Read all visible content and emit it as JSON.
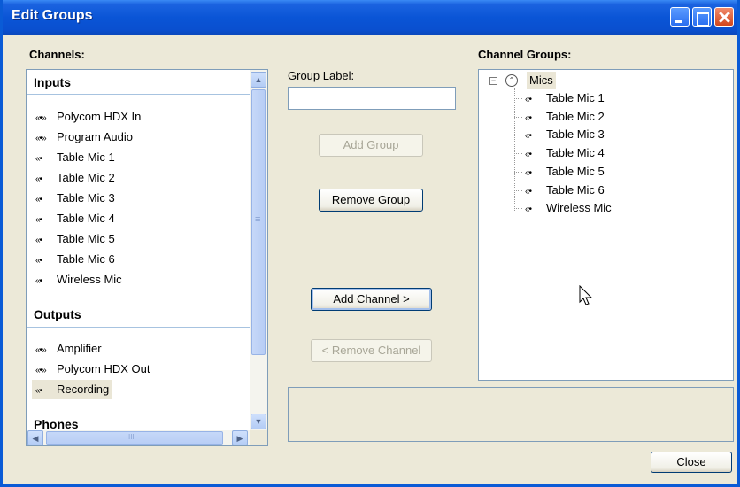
{
  "window": {
    "title": "Edit Groups"
  },
  "channels": {
    "label": "Channels:",
    "groups": [
      {
        "name": "Inputs",
        "items": [
          {
            "icon": "dual-signal-icon",
            "label": "Polycom HDX In"
          },
          {
            "icon": "dual-signal-icon",
            "label": "Program Audio"
          },
          {
            "icon": "signal-icon",
            "label": "Table Mic 1"
          },
          {
            "icon": "signal-icon",
            "label": "Table Mic 2"
          },
          {
            "icon": "signal-icon",
            "label": "Table Mic 3"
          },
          {
            "icon": "signal-icon",
            "label": "Table Mic 4"
          },
          {
            "icon": "signal-icon",
            "label": "Table Mic 5"
          },
          {
            "icon": "signal-icon",
            "label": "Table Mic 6"
          },
          {
            "icon": "signal-icon",
            "label": "Wireless Mic"
          }
        ]
      },
      {
        "name": "Outputs",
        "items": [
          {
            "icon": "dual-signal-icon",
            "label": "Amplifier"
          },
          {
            "icon": "dual-signal-icon",
            "label": "Polycom HDX Out"
          },
          {
            "icon": "signal-icon",
            "label": "Recording",
            "selected": true
          }
        ]
      },
      {
        "name": "Phones",
        "items": []
      }
    ]
  },
  "form": {
    "group_label": "Group Label:",
    "group_label_value": "",
    "add_group": "Add Group",
    "remove_group": "Remove Group",
    "add_channel": "Add Channel >",
    "remove_channel": "< Remove Channel"
  },
  "channel_groups": {
    "label": "Channel Groups:",
    "tree": {
      "name": "Mics",
      "expanded": true,
      "children": [
        "Table Mic 1",
        "Table Mic 2",
        "Table Mic 3",
        "Table Mic 4",
        "Table Mic 5",
        "Table Mic 6",
        "Wireless Mic"
      ]
    }
  },
  "footer": {
    "close": "Close"
  },
  "glyphs": {
    "dual": "«•»",
    "single": "«•",
    "expander": "−",
    "group": "⌃⌃"
  },
  "colors": {
    "titlebar": "#0a55d6",
    "selection": "#eae6d6",
    "border": "#7f9db9"
  }
}
